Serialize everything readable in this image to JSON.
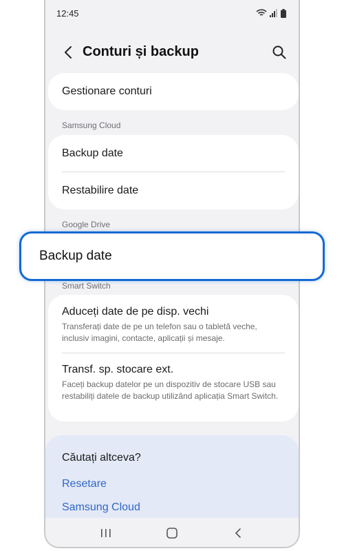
{
  "status_bar": {
    "time": "12:45"
  },
  "header": {
    "title": "Conturi și backup"
  },
  "manage_accounts": {
    "label": "Gestionare conturi"
  },
  "samsung_cloud": {
    "section_label": "Samsung Cloud",
    "items": [
      {
        "label": "Backup date"
      },
      {
        "label": "Restabilire date"
      }
    ]
  },
  "google_drive": {
    "section_label": "Google Drive",
    "backup_label": "Backup date"
  },
  "smart_switch": {
    "section_label": "Smart Switch",
    "items": [
      {
        "label": "Aduceți date de pe disp. vechi",
        "description": "Transferați date de pe un telefon sau o tabletă veche, inclusiv imagini, contacte, aplicații și mesaje."
      },
      {
        "label": "Transf. sp. stocare ext.",
        "description": "Faceți backup datelor pe un dispozitiv de stocare USB sau restabiliți datele de backup utilizând aplicația Smart Switch."
      }
    ]
  },
  "suggestions": {
    "heading": "Căutați altceva?",
    "links": [
      {
        "label": "Resetare"
      },
      {
        "label": "Samsung Cloud"
      }
    ]
  },
  "colors": {
    "accent": "#1469d2",
    "link": "#2f67c9",
    "background": "#f2f2f5",
    "suggestion_bg": "#e3e9f6"
  },
  "icons": {
    "back": "chevron-left-icon",
    "search": "search-icon",
    "wifi": "wifi-icon",
    "signal": "signal-icon",
    "battery": "battery-icon",
    "recents": "recents-icon",
    "home": "home-icon",
    "nav_back": "nav-back-icon"
  }
}
